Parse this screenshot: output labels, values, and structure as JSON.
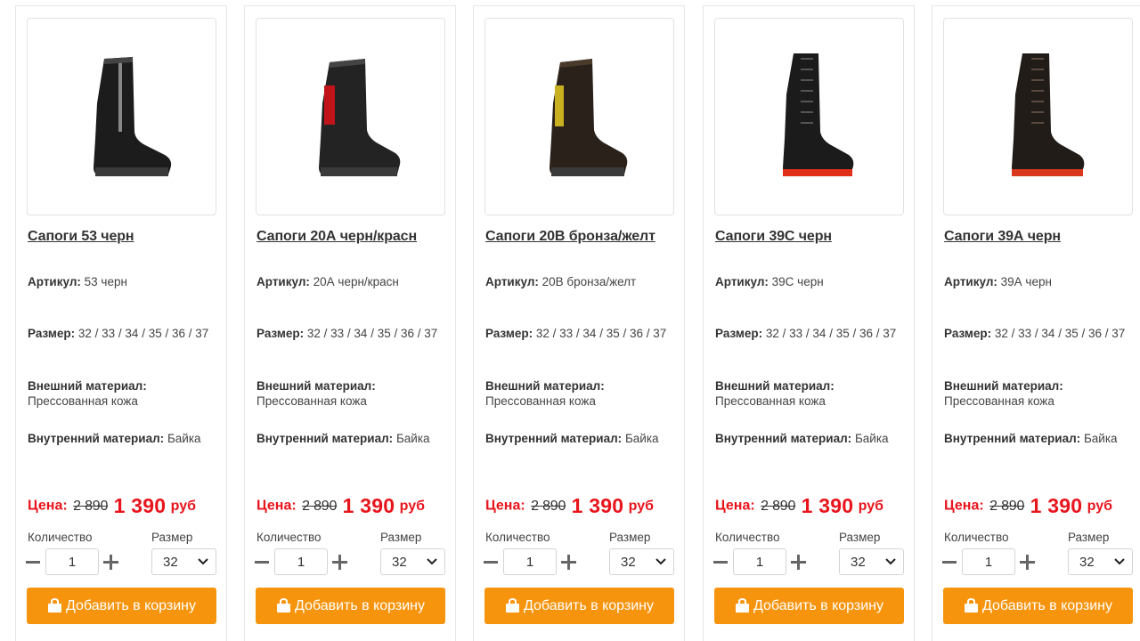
{
  "labels": {
    "article": "Артикул:",
    "size": "Размер:",
    "outer": "Внешний материал:",
    "inner": "Внутренний материал:",
    "price": "Цена:",
    "quantity": "Количество",
    "size_select": "Размер",
    "add_to_cart": "Добавить в корзину",
    "currency": "руб"
  },
  "colors": {
    "accent": "#f7940d",
    "price_red": "#e8141c"
  },
  "products": [
    {
      "title": "Сапоги 53 черн",
      "article": "53 черн",
      "sizes": "32 / 33 / 34 / 35 / 36 / 37",
      "outer_material": "Прессованная кожа",
      "inner_material": "Байка",
      "old_price": "2 890",
      "new_price": "1 390",
      "quantity": "1",
      "size_selected": "32",
      "image_icon": "black-zip-boot"
    },
    {
      "title": "Сапоги 20А черн/красн",
      "article": "20А черн/красн",
      "sizes": "32 / 33 / 34 / 35 / 36 / 37",
      "outer_material": "Прессованная кожа",
      "inner_material": "Байка",
      "old_price": "2 890",
      "new_price": "1 390",
      "quantity": "1",
      "size_selected": "32",
      "image_icon": "black-red-boot"
    },
    {
      "title": "Сапоги 20В бронза/желт",
      "article": "20В бронза/желт",
      "sizes": "32 / 33 / 34 / 35 / 36 / 37",
      "outer_material": "Прессованная кожа",
      "inner_material": "Байка",
      "old_price": "2 890",
      "new_price": "1 390",
      "quantity": "1",
      "size_selected": "32",
      "image_icon": "brown-yellow-boot"
    },
    {
      "title": "Сапоги 39С черн",
      "article": "39С черн",
      "sizes": "32 / 33 / 34 / 35 / 36 / 37",
      "outer_material": "Прессованная кожа",
      "inner_material": "Байка",
      "old_price": "2 890",
      "new_price": "1 390",
      "quantity": "1",
      "size_selected": "32",
      "image_icon": "black-lace-boot"
    },
    {
      "title": "Сапоги 39А черн",
      "article": "39А черн",
      "sizes": "32 / 33 / 34 / 35 / 36 / 37",
      "outer_material": "Прессованная кожа",
      "inner_material": "Байка",
      "old_price": "2 890",
      "new_price": "1 390",
      "quantity": "1",
      "size_selected": "32",
      "image_icon": "black-lace-boot-2"
    }
  ]
}
